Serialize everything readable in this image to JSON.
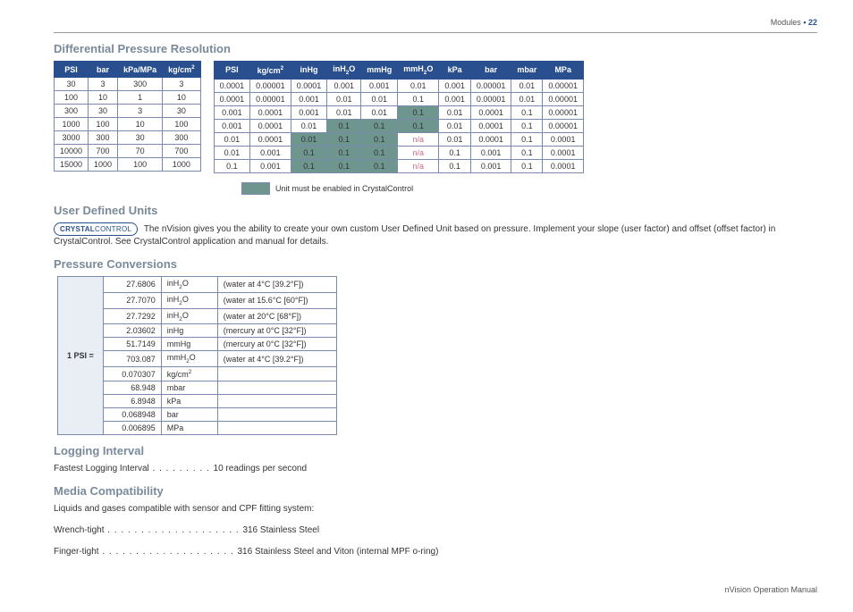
{
  "header": {
    "section": "Modules",
    "page": "22"
  },
  "footer": {
    "text": "nVision Operation Manual"
  },
  "sections": {
    "diff": "Differential Pressure Resolution",
    "udu": "User Defined Units",
    "pconv": "Pressure Conversions",
    "log": "Logging Interval",
    "media": "Media Compatibility"
  },
  "chart_data": {
    "tableA": {
      "type": "table",
      "headers": [
        "PSI",
        "bar",
        "kPa/MPa",
        "kg/cm²"
      ],
      "rows": [
        [
          "30",
          "3",
          "300",
          "3"
        ],
        [
          "100",
          "10",
          "1",
          "10"
        ],
        [
          "300",
          "30",
          "3",
          "30"
        ],
        [
          "1000",
          "100",
          "10",
          "100"
        ],
        [
          "3000",
          "300",
          "30",
          "300"
        ],
        [
          "10000",
          "700",
          "70",
          "700"
        ],
        [
          "15000",
          "1000",
          "100",
          "1000"
        ]
      ]
    },
    "tableB": {
      "type": "table",
      "headers": [
        "PSI",
        "kg/cm²",
        "inHg",
        "inH₂O",
        "mmHg",
        "mmH₂O",
        "kPa",
        "bar",
        "mbar",
        "MPa"
      ],
      "rows": [
        {
          "v": [
            "0.0001",
            "0.00001",
            "0.0001",
            "0.001",
            "0.001",
            "0.01",
            "0.001",
            "0.00001",
            "0.01",
            "0.00001"
          ],
          "hl": [],
          "na": []
        },
        {
          "v": [
            "0.0001",
            "0.00001",
            "0.001",
            "0.01",
            "0.01",
            "0.1",
            "0.001",
            "0.00001",
            "0.01",
            "0.00001"
          ],
          "hl": [],
          "na": []
        },
        {
          "v": [
            "0.001",
            "0.0001",
            "0.001",
            "0.01",
            "0.01",
            "0.1",
            "0.01",
            "0.0001",
            "0.1",
            "0.00001"
          ],
          "hl": [
            5
          ],
          "na": []
        },
        {
          "v": [
            "0.001",
            "0.0001",
            "0.01",
            "0.1",
            "0.1",
            "0.1",
            "0.01",
            "0.0001",
            "0.1",
            "0.00001"
          ],
          "hl": [
            3,
            4,
            5
          ],
          "na": []
        },
        {
          "v": [
            "0.01",
            "0.0001",
            "0.01",
            "0.1",
            "0.1",
            "n/a",
            "0.01",
            "0.0001",
            "0.1",
            "0.0001"
          ],
          "hl": [
            2,
            3,
            4
          ],
          "na": [
            5
          ]
        },
        {
          "v": [
            "0.01",
            "0.001",
            "0.1",
            "0.1",
            "0.1",
            "n/a",
            "0.1",
            "0.001",
            "0.1",
            "0.0001"
          ],
          "hl": [
            2,
            3,
            4
          ],
          "na": [
            5
          ]
        },
        {
          "v": [
            "0.1",
            "0.001",
            "0.1",
            "0.1",
            "0.1",
            "n/a",
            "0.1",
            "0.001",
            "0.1",
            "0.0001"
          ],
          "hl": [
            2,
            3,
            4
          ],
          "na": [
            5
          ]
        }
      ]
    },
    "conversions": {
      "type": "table",
      "lead": "1 PSI =",
      "rows": [
        {
          "val": "27.6806",
          "unit": "inH₂O",
          "cond": "(water at 4°C [39.2°F])"
        },
        {
          "val": "27.7070",
          "unit": "inH₂O",
          "cond": "(water at 15.6°C [60°F])"
        },
        {
          "val": "27.7292",
          "unit": "inH₂O",
          "cond": "(water at 20°C [68°F])"
        },
        {
          "val": "2.03602",
          "unit": "inHg",
          "cond": "(mercury at 0°C [32°F])"
        },
        {
          "val": "51.7149",
          "unit": "mmHg",
          "cond": "(mercury at 0°C [32°F])"
        },
        {
          "val": "703.087",
          "unit": "mmH₂O",
          "cond": "(water at 4°C [39.2°F])"
        },
        {
          "val": "0.070307",
          "unit": "kg/cm²",
          "cond": ""
        },
        {
          "val": "68.948",
          "unit": "mbar",
          "cond": ""
        },
        {
          "val": "6.8948",
          "unit": "kPa",
          "cond": ""
        },
        {
          "val": "0.068948",
          "unit": "bar",
          "cond": ""
        },
        {
          "val": "0.006895",
          "unit": "MPa",
          "cond": ""
        }
      ]
    }
  },
  "legend": {
    "text": "Unit must be enabled in CrystalControl"
  },
  "udu_text": "The nVision gives you the ability to create your own custom User Defined Unit based on pressure. Implement your slope (user factor) and offset (offset factor) in CrystalControl. See CrystalControl application and manual for details.",
  "crystal_badge": {
    "bold": "CRYSTAL",
    "rest": "CONTROL"
  },
  "logging": {
    "label": "Fastest Logging Interval",
    "value": "10 readings per second"
  },
  "media": {
    "intro": "Liquids and gases compatible with sensor and CPF fitting system:",
    "items": [
      {
        "label": "Wrench-tight",
        "value": "316 Stainless Steel"
      },
      {
        "label": "Finger-tight",
        "value": "316 Stainless Steel and Viton (internal MPF o-ring)"
      }
    ]
  }
}
